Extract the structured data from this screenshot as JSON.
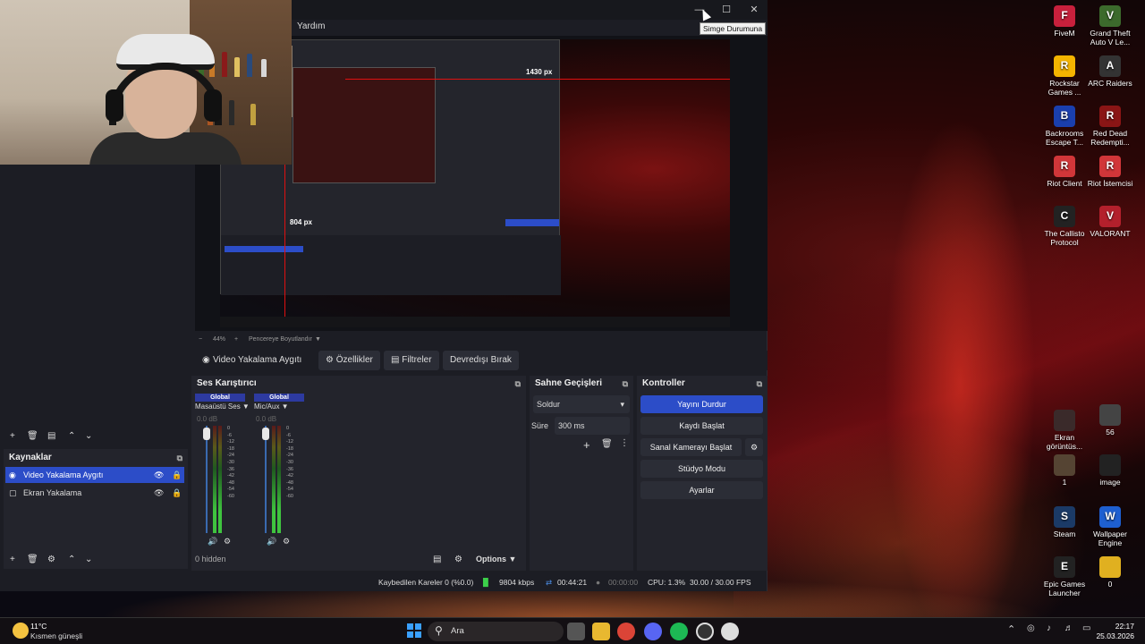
{
  "obs": {
    "menu_help": "Yardım",
    "tooltip": "Simge Durumuna",
    "preview": {
      "px_top": "1430 px",
      "px_left": "804 px",
      "zoom": "44%",
      "fit": "Pencereye Boyutlandır"
    },
    "source_toolbar": {
      "source_name": "Video Yakalama Aygıtı",
      "properties": "Özellikler",
      "filters": "Filtreler",
      "deactivate": "Devredışı Bırak"
    },
    "mixer": {
      "title": "Ses Karıştırıcı",
      "channels": [
        {
          "tag": "Global",
          "name": "Masaüstü Ses",
          "db": "0.0 dB"
        },
        {
          "tag": "Global",
          "name": "Mic/Aux",
          "db": "0.0 dB"
        }
      ],
      "scale": [
        "0",
        "-6",
        "-12",
        "-18",
        "-24",
        "-30",
        "-36",
        "-42",
        "-48",
        "-54",
        "-60"
      ],
      "hidden": "0 hidden",
      "options": "Options"
    },
    "transitions": {
      "title": "Sahne Geçişleri",
      "selected": "Soldur",
      "duration_label": "Süre",
      "duration_value": "300 ms"
    },
    "controls": {
      "title": "Kontroller",
      "stop_stream": "Yayını Durdur",
      "start_recording": "Kaydı Başlat",
      "start_virtualcam": "Sanal Kamerayı Başlat",
      "studio_mode": "Stüdyo Modu",
      "settings": "Ayarlar"
    },
    "sources": {
      "title": "Kaynaklar",
      "items": [
        "Video Yakalama Aygıtı",
        "Ekran Yakalama"
      ]
    },
    "status": {
      "dropped": "Kaybedilen Kareler 0 (%0.0)",
      "bitrate": "9804 kbps",
      "stream_time": "00:44:21",
      "rec_time": "00:00:00",
      "cpu": "CPU: 1.3%",
      "fps": "30.00 / 30.00 FPS"
    }
  },
  "desktop": {
    "icons": [
      {
        "label": "FiveM",
        "color": "#c8203c",
        "glyph": "F"
      },
      {
        "label": "Grand Theft Auto V Le...",
        "color": "#3c6a2c",
        "glyph": "V"
      },
      {
        "label": "Rockstar Games ...",
        "color": "#f4b400",
        "glyph": "R"
      },
      {
        "label": "ARC Raiders",
        "color": "#333333",
        "glyph": "A"
      },
      {
        "label": "Backrooms Escape T...",
        "color": "#1a3fae",
        "glyph": "B"
      },
      {
        "label": "Red Dead Redempti...",
        "color": "#8a1515",
        "glyph": "R"
      },
      {
        "label": "Riot Client",
        "color": "#d13639",
        "glyph": "R"
      },
      {
        "label": "Riot İstemcisi",
        "color": "#d13639",
        "glyph": "R"
      },
      {
        "label": "The Callisto Protocol",
        "color": "#222222",
        "glyph": "C"
      },
      {
        "label": "VALORANT",
        "color": "#b3202c",
        "glyph": "V"
      },
      {
        "label": "Ekran görüntüs...",
        "color": "#3a2a2a",
        "glyph": ""
      },
      {
        "label": "56",
        "color": "#444444",
        "glyph": ""
      },
      {
        "label": "1",
        "color": "#554433",
        "glyph": ""
      },
      {
        "label": "image",
        "color": "#222222",
        "glyph": ""
      },
      {
        "label": "Steam",
        "color": "#1b3a66",
        "glyph": "S"
      },
      {
        "label": "Wallpaper Engine",
        "color": "#1e5fd0",
        "glyph": "W"
      },
      {
        "label": "Epic Games Launcher",
        "color": "#222222",
        "glyph": "E"
      },
      {
        "label": "0",
        "color": "#e0b020",
        "glyph": ""
      }
    ]
  },
  "taskbar": {
    "weather_temp": "11°C",
    "weather_desc": "Kısmen güneşli",
    "search": "Ara",
    "time": "22:17",
    "date": "25.03.2026"
  }
}
